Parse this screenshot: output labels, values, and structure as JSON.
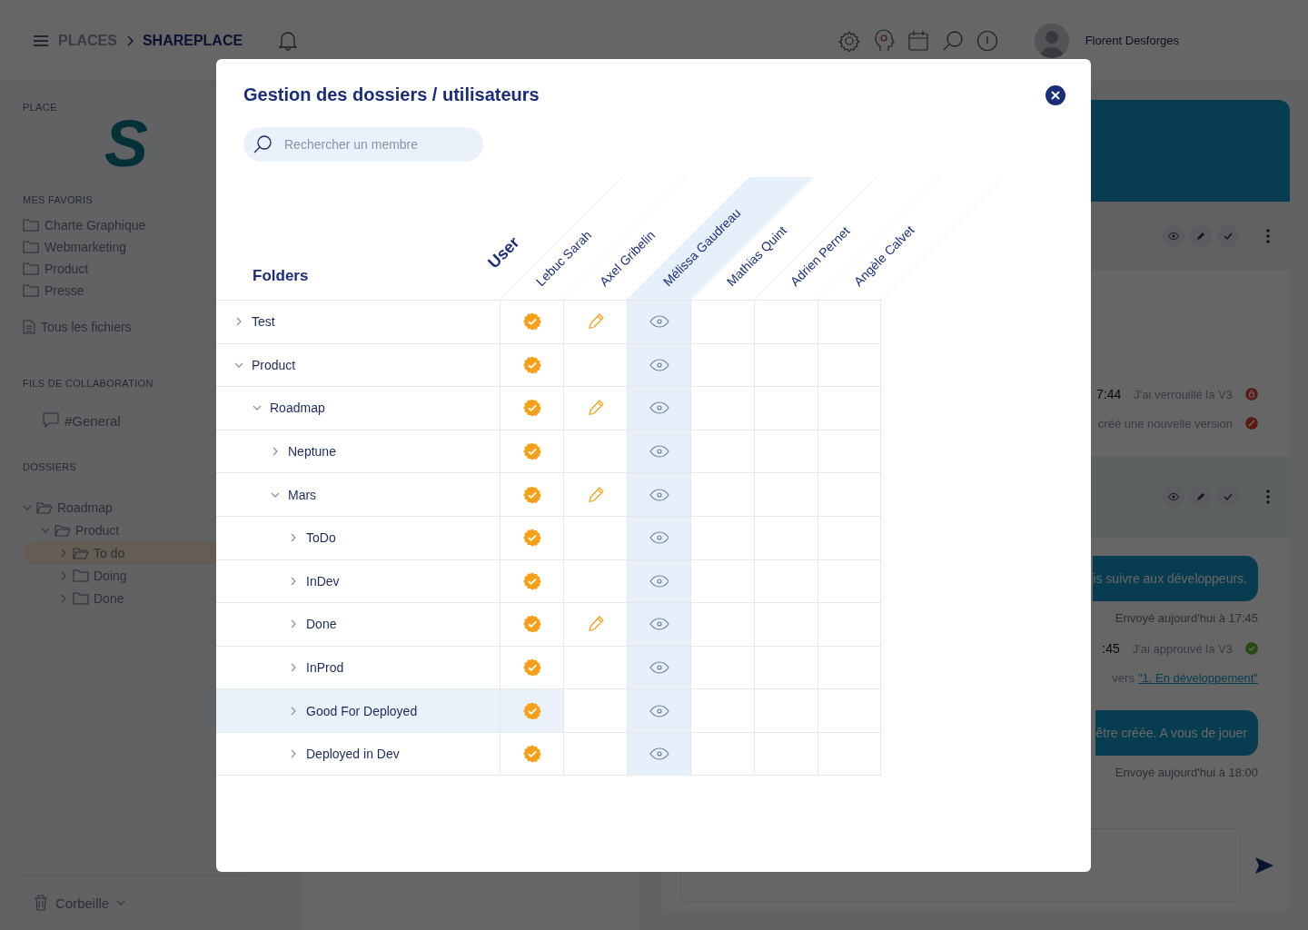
{
  "topbar": {
    "breadcrumb": [
      {
        "label": "PLACES",
        "selected": false
      },
      {
        "label": "SHAREPLACE",
        "selected": true
      }
    ],
    "user_name": "Florent Desforges"
  },
  "sidebar": {
    "place_label": "PLACE",
    "logo": "S",
    "favorites_label": "MES FAVORIS",
    "favorites": [
      "Charte Graphique",
      "Webmarketing",
      "Product",
      "Presse"
    ],
    "all_files": "Tous les fichiers",
    "threads_label": "FILS DE COLLABORATION",
    "threads": [
      "#General"
    ],
    "folders_label": "DOSSIERS",
    "folders": [
      {
        "label": "Roadmap",
        "expanded": true,
        "selected": false,
        "children": [
          {
            "label": "Product",
            "expanded": true,
            "selected": false,
            "children": [
              {
                "label": "To do",
                "expanded": false,
                "selected": true
              },
              {
                "label": "Doing",
                "expanded": false,
                "selected": false
              },
              {
                "label": "Done",
                "expanded": false,
                "selected": false
              }
            ]
          }
        ]
      }
    ],
    "trash": "Corbeille"
  },
  "activity": {
    "events": [
      {
        "time": "7:44",
        "text": "J'ai verrouillé la V3",
        "badge": {
          "kind": "locked"
        }
      },
      {
        "text": "créé une nouvelle version",
        "badge": {
          "kind": "cancelled"
        }
      }
    ],
    "feed": [
      {
        "kind": "bubble",
        "text": "is suivre aux développeurs."
      },
      {
        "kind": "sent",
        "text": "Envoyé aujourd'hui à 17:45"
      },
      {
        "kind": "event",
        "time": ":45",
        "text": "J'ai approuvé la V3",
        "badge": {
          "kind": "approved"
        }
      },
      {
        "kind": "move",
        "text": "vers",
        "link": "\"1. En développement\""
      },
      {
        "kind": "bubble",
        "text": "être créée. A vous de jouer"
      },
      {
        "kind": "sent",
        "text": "Envoyé aujourd'hui à 18:00"
      }
    ]
  },
  "modal": {
    "title": "Gestion des dossiers / utilisateurs",
    "search": {
      "placeholder": "Rechercher un membre"
    },
    "folders_heading": "Folders",
    "users_heading": "User",
    "users": [
      {
        "name": "Lebuc Sarah",
        "selected": false
      },
      {
        "name": "Axel Gribelin",
        "selected": false
      },
      {
        "name": "Mélissa Gaudreau",
        "selected": true
      },
      {
        "name": "Mathias Quint",
        "selected": false
      },
      {
        "name": "Adrien Pernet",
        "selected": false
      },
      {
        "name": "Angèle Calvet",
        "selected": false
      }
    ],
    "rows": [
      {
        "label": "Test",
        "expanded": false,
        "selected": false,
        "cells": [
          {
            "kind": "admin"
          },
          {
            "kind": "edit"
          },
          {
            "kind": "view"
          },
          {
            "kind": "none"
          },
          {
            "kind": "none"
          },
          {
            "kind": "none"
          }
        ]
      },
      {
        "label": "Product",
        "expanded": true,
        "selected": false,
        "cells": [
          {
            "kind": "admin"
          },
          {
            "kind": "none"
          },
          {
            "kind": "view"
          },
          {
            "kind": "none"
          },
          {
            "kind": "none"
          },
          {
            "kind": "none"
          }
        ],
        "children": [
          {
            "label": "Roadmap",
            "expanded": true,
            "selected": false,
            "cells": [
              {
                "kind": "admin"
              },
              {
                "kind": "edit"
              },
              {
                "kind": "view"
              },
              {
                "kind": "none"
              },
              {
                "kind": "none"
              },
              {
                "kind": "none"
              }
            ],
            "children": [
              {
                "label": "Neptune",
                "expanded": false,
                "selected": false,
                "cells": [
                  {
                    "kind": "admin"
                  },
                  {
                    "kind": "none"
                  },
                  {
                    "kind": "view"
                  },
                  {
                    "kind": "none"
                  },
                  {
                    "kind": "none"
                  },
                  {
                    "kind": "none"
                  }
                ]
              },
              {
                "label": "Mars",
                "expanded": true,
                "selected": false,
                "cells": [
                  {
                    "kind": "admin"
                  },
                  {
                    "kind": "edit"
                  },
                  {
                    "kind": "view"
                  },
                  {
                    "kind": "none"
                  },
                  {
                    "kind": "none"
                  },
                  {
                    "kind": "none"
                  }
                ],
                "children": [
                  {
                    "label": "ToDo",
                    "expanded": false,
                    "selected": false,
                    "cells": [
                      {
                        "kind": "admin"
                      },
                      {
                        "kind": "none"
                      },
                      {
                        "kind": "view"
                      },
                      {
                        "kind": "none"
                      },
                      {
                        "kind": "none"
                      },
                      {
                        "kind": "none"
                      }
                    ]
                  },
                  {
                    "label": "InDev",
                    "expanded": false,
                    "selected": false,
                    "cells": [
                      {
                        "kind": "admin"
                      },
                      {
                        "kind": "none"
                      },
                      {
                        "kind": "view"
                      },
                      {
                        "kind": "none"
                      },
                      {
                        "kind": "none"
                      },
                      {
                        "kind": "none"
                      }
                    ]
                  },
                  {
                    "label": "Done",
                    "expanded": false,
                    "selected": false,
                    "cells": [
                      {
                        "kind": "admin"
                      },
                      {
                        "kind": "edit"
                      },
                      {
                        "kind": "view"
                      },
                      {
                        "kind": "none"
                      },
                      {
                        "kind": "none"
                      },
                      {
                        "kind": "none"
                      }
                    ]
                  },
                  {
                    "label": "InProd",
                    "expanded": false,
                    "selected": false,
                    "cells": [
                      {
                        "kind": "admin"
                      },
                      {
                        "kind": "none"
                      },
                      {
                        "kind": "view"
                      },
                      {
                        "kind": "none"
                      },
                      {
                        "kind": "none"
                      },
                      {
                        "kind": "none"
                      }
                    ]
                  },
                  {
                    "label": "Good For Deployed",
                    "expanded": false,
                    "selected": true,
                    "cells": [
                      {
                        "kind": "admin"
                      },
                      {
                        "kind": "none"
                      },
                      {
                        "kind": "view"
                      },
                      {
                        "kind": "none"
                      },
                      {
                        "kind": "none"
                      },
                      {
                        "kind": "none"
                      }
                    ]
                  },
                  {
                    "label": "Deployed in Dev",
                    "expanded": false,
                    "selected": false,
                    "cells": [
                      {
                        "kind": "admin"
                      },
                      {
                        "kind": "none"
                      },
                      {
                        "kind": "view"
                      },
                      {
                        "kind": "none"
                      },
                      {
                        "kind": "none"
                      },
                      {
                        "kind": "none"
                      }
                    ]
                  }
                ]
              }
            ]
          }
        ]
      }
    ]
  }
}
